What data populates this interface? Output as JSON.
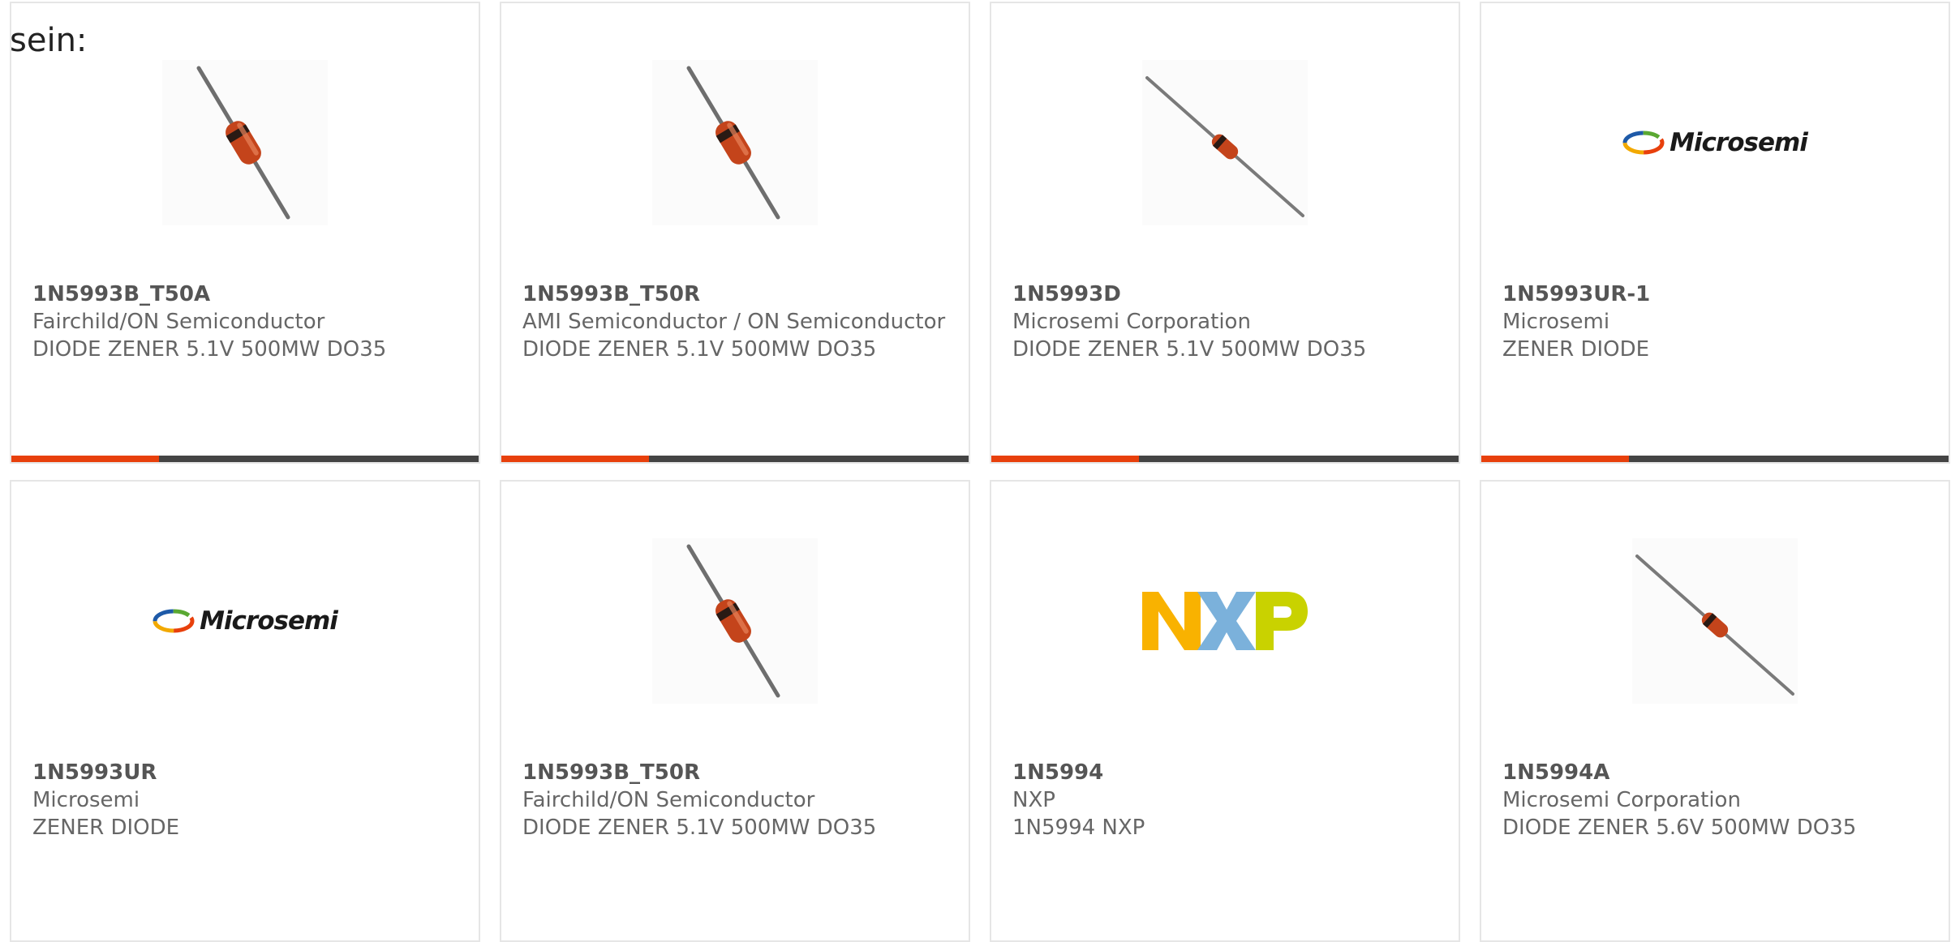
{
  "intro": {
    "text": "sein:"
  },
  "cards": [
    {
      "part_number": "1N5993B_T50A",
      "manufacturer": "Fairchild/ON Semiconductor",
      "description": "DIODE ZENER 5.1V 500MW DO35",
      "image": "diode-photo-steep"
    },
    {
      "part_number": "1N5993B_T50R",
      "manufacturer": "AMI Semiconductor / ON Semiconductor",
      "description": "DIODE ZENER 5.1V 500MW DO35",
      "image": "diode-photo-steep"
    },
    {
      "part_number": "1N5993D",
      "manufacturer": "Microsemi Corporation",
      "description": "DIODE ZENER 5.1V 500MW DO35",
      "image": "diode-photo-shallow"
    },
    {
      "part_number": "1N5993UR-1",
      "manufacturer": "Microsemi",
      "description": "ZENER DIODE",
      "image": "microsemi-logo"
    },
    {
      "part_number": "1N5993UR",
      "manufacturer": "Microsemi",
      "description": "ZENER DIODE",
      "image": "microsemi-logo"
    },
    {
      "part_number": "1N5993B_T50R",
      "manufacturer": "Fairchild/ON Semiconductor",
      "description": "DIODE ZENER 5.1V 500MW DO35",
      "image": "diode-photo-steep"
    },
    {
      "part_number": "1N5994",
      "manufacturer": "NXP",
      "description": "1N5994 NXP",
      "image": "nxp-logo"
    },
    {
      "part_number": "1N5994A",
      "manufacturer": "Microsemi Corporation",
      "description": "DIODE ZENER 5.6V 500MW DO35",
      "image": "diode-photo-shallow"
    }
  ],
  "logos": {
    "microsemi_word": "Microsemi",
    "nxp_letters": [
      "N",
      "X",
      "P"
    ]
  },
  "colors": {
    "accent": "#e8400c",
    "bar_dark": "#444444",
    "card_border": "#e6e6e6",
    "text_muted": "#666666",
    "nxp_yellow": "#f9b200",
    "nxp_blue": "#7bb1db",
    "nxp_green": "#c9d200"
  }
}
